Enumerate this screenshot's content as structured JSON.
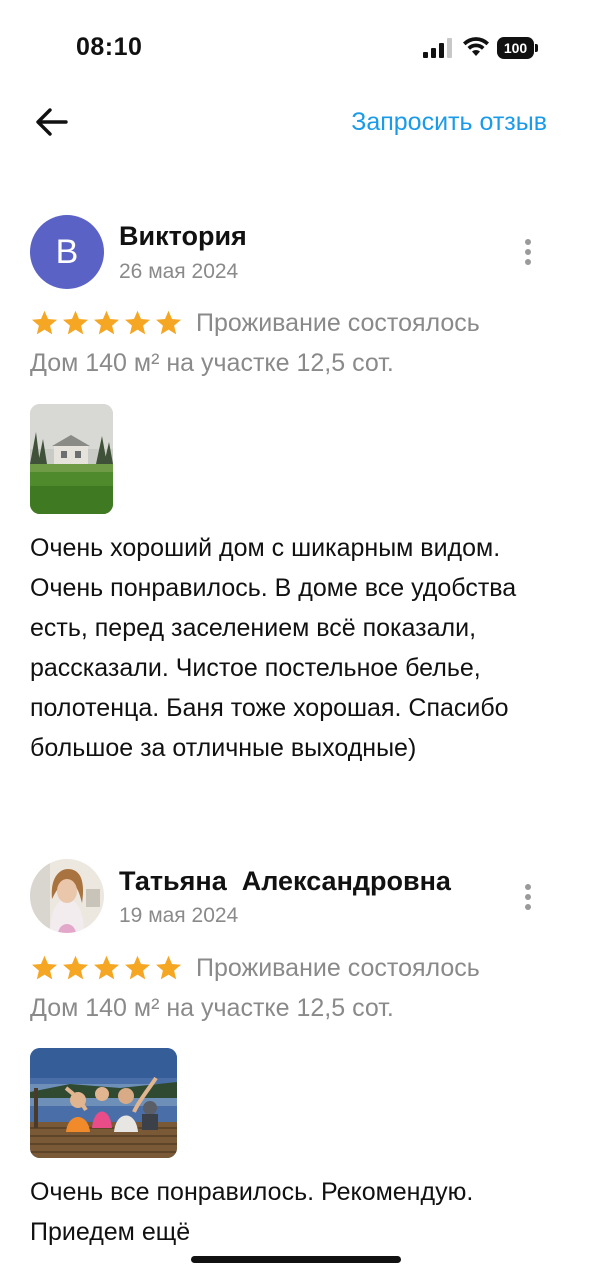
{
  "status_bar": {
    "time": "08:10",
    "battery": "100"
  },
  "nav": {
    "back_icon": "arrow-left-icon",
    "request_review_label": "Запросить отзыв"
  },
  "colors": {
    "accent": "#1a9bea",
    "star": "#f5a623",
    "avatar_bg": "#5a62c6",
    "secondary_text": "#8a8a8a"
  },
  "reviews": [
    {
      "avatar_letter": "В",
      "name": "Виктория",
      "date": "26 мая 2024",
      "rating": 5,
      "stay_status": "Проживание состоялось",
      "property": "Дом 140 м² на участке 12,5 сот.",
      "text": "Очень хороший дом с шикарным видом. Очень понравилось. В доме все удобства есть, перед заселением всё показали, рассказали. Чистое постельное белье, полотенца. Баня тоже хорошая. Спасибо большое за отличные выходные)"
    },
    {
      "avatar_letter": "",
      "name": "Татьяна  Александровна",
      "date": "19 мая 2024",
      "rating": 5,
      "stay_status": "Проживание состоялось",
      "property": "Дом 140 м² на участке 12,5 сот.",
      "text": "Очень все понравилось. Рекомендую. Приедем ещё"
    }
  ]
}
